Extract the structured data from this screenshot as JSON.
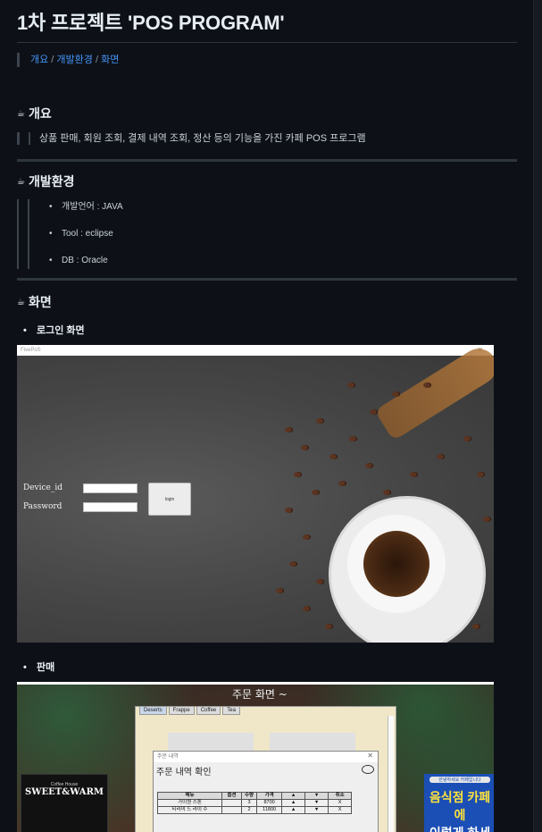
{
  "page": {
    "title": "1차 프로젝트 'POS PROGRAM'",
    "breadcrumb": {
      "link1": "개요",
      "sep": " / ",
      "link2": "개발환경",
      "link3": "화면"
    }
  },
  "overview": {
    "icon": "coffee-cup-icon",
    "heading": "개요",
    "text": "상품 판매, 회원 조회, 결제 내역 조회, 정산 등의 기능을 가진 카페 POS 프로그램"
  },
  "environment": {
    "icon": "coffee-cup-icon",
    "heading": "개발환경",
    "items": [
      "개발언어 : JAVA",
      "Tool : eclipse",
      "DB : Oracle"
    ]
  },
  "screens": {
    "icon": "coffee-cup-icon",
    "heading": "화면",
    "login": {
      "title": "로그인 화면",
      "window_title": "FivePoS",
      "device_label": "Device_id",
      "password_label": "Password",
      "login_button": "login"
    },
    "sale": {
      "title": "판매",
      "header": "주문 화면 ~",
      "tabs": [
        "Deserts",
        "Frappe",
        "Coffee",
        "Tea"
      ],
      "dialog_window_title": "주문 내역",
      "dialog_title": "주문 내역 확인",
      "table_headers": [
        "메뉴",
        "옵션",
        "수량",
        "가격",
        "▲",
        "▼",
        "취소"
      ],
      "rows": [
        [
          "가이원 스톤",
          "",
          "3",
          "8700",
          "▲",
          "▼",
          "X"
        ],
        [
          "티라미 드 라이 수",
          "",
          "2",
          "11800",
          "▲",
          "▼",
          "X"
        ]
      ],
      "poster_left_top": "Coffee House",
      "poster_left_title": "SWEET&WARM",
      "poster_right_badge": "안녕하세요 카페입니다",
      "poster_right_line1": "음식점 카페 에",
      "poster_right_line2": "이렇게 하세요"
    }
  }
}
